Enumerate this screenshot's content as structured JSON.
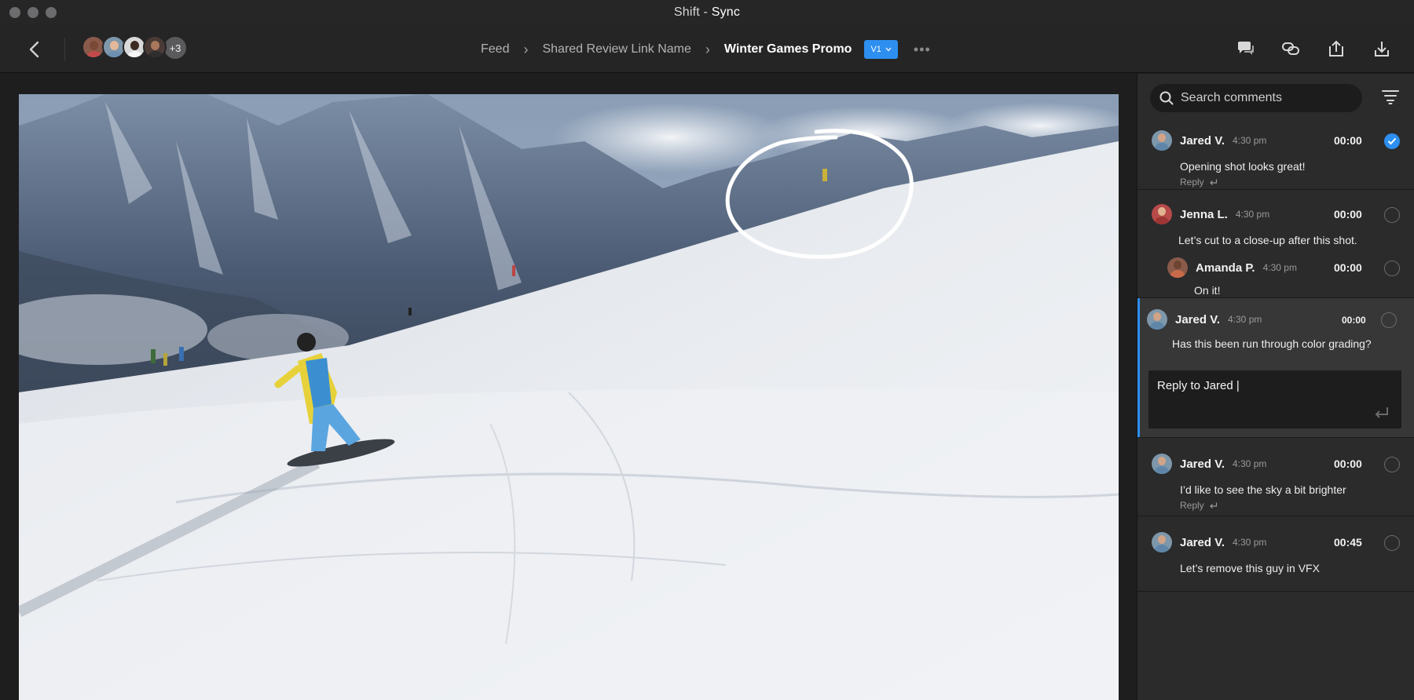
{
  "window": {
    "title_app": "Shift",
    "title_sep": " - ",
    "title_project": "Sync"
  },
  "header": {
    "avatars_more": "+3",
    "breadcrumb": [
      "Feed",
      "Shared Review Link Name",
      "Winter Games Promo"
    ],
    "version": "V1",
    "more": "•••"
  },
  "comments_panel": {
    "search_placeholder": "Search comments",
    "comments": [
      {
        "author": "Jared V.",
        "time": "4:30 pm",
        "timecode": "00:00",
        "text": "Opening shot looks great!",
        "reply_label": "Reply",
        "resolved": true
      },
      {
        "author": "Jenna L.",
        "time": "4:30 pm",
        "timecode": "00:00",
        "text": "Let’s cut to a close-up after this shot.",
        "resolved": false
      },
      {
        "author": "Amanda P.",
        "time": "4:30 pm",
        "timecode": "00:00",
        "text": "On it!",
        "resolved": false
      },
      {
        "author": "Jared V.",
        "time": "4:30 pm",
        "timecode": "00:00",
        "text": "Has this been run through color grading?",
        "resolved": false,
        "reply_input": "Reply to Jared |"
      },
      {
        "author": "Jared V.",
        "time": "4:30 pm",
        "timecode": "00:00",
        "text": "I’d like to see the sky a bit brighter",
        "reply_label": "Reply",
        "resolved": false
      },
      {
        "author": "Jared V.",
        "time": "4:30 pm",
        "timecode": "00:45",
        "text": "Let’s remove this guy in VFX",
        "resolved": false
      }
    ]
  },
  "colors": {
    "accent": "#2d8ff0",
    "panel_bg": "#2b2b2c",
    "header_bg": "#252526"
  },
  "icons": [
    "back-icon",
    "chat-icon",
    "link-icon",
    "upload-icon",
    "download-icon",
    "search-icon",
    "filter-icon",
    "check-icon",
    "enter-icon",
    "chevron-down-icon"
  ]
}
